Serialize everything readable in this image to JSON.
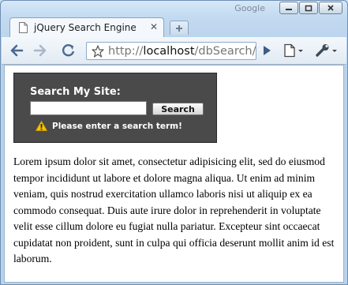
{
  "window": {
    "brand": "Google"
  },
  "tab": {
    "title": "jQuery Search Engine",
    "close_label": "✕"
  },
  "toolbar": {
    "url_scheme": "http://",
    "url_host": "localhost",
    "url_path": "/dbSearch/"
  },
  "search": {
    "heading": "Search My Site:",
    "input_value": "",
    "button_label": "Search",
    "warning": "Please enter a search term!"
  },
  "body_text": "Lorem ipsum dolor sit amet, consectetur adipisicing elit, sed do eiusmod tempor incididunt ut labore et dolore magna aliqua. Ut enim ad minim veniam, quis nostrud exercitation ullamco laboris nisi ut aliquip ex ea commodo consequat. Duis aute irure dolor in reprehenderit in voluptate velit esse cillum dolore eu fugiat nulla pariatur. Excepteur sint occaecat cupidatat non proident, sunt in culpa qui officia deserunt mollit anim id est laborum.",
  "colors": {
    "search_panel": "#4a4a4a",
    "warning_icon": "#f5c400"
  }
}
